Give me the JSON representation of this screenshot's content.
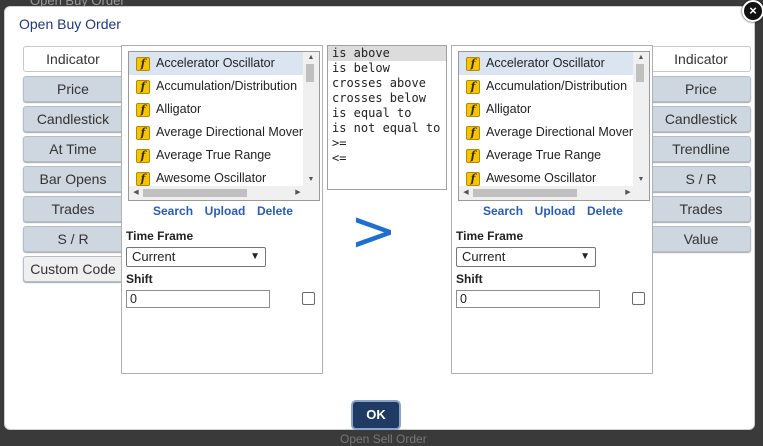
{
  "backdrop": {
    "top_text": "Open Buy Order",
    "bottom_text": "Open Sell Order"
  },
  "dialog": {
    "title": "Open Buy Order",
    "close_glyph": "×"
  },
  "left_tabs": [
    {
      "label": "Indicator",
      "active": true
    },
    {
      "label": "Price"
    },
    {
      "label": "Candlestick"
    },
    {
      "label": "At Time"
    },
    {
      "label": "Bar Opens"
    },
    {
      "label": "Trades"
    },
    {
      "label": "S / R"
    },
    {
      "label": "Custom Code"
    }
  ],
  "right_tabs": [
    {
      "label": "Indicator",
      "active": true
    },
    {
      "label": "Price"
    },
    {
      "label": "Candlestick"
    },
    {
      "label": "Trendline"
    },
    {
      "label": "S / R"
    },
    {
      "label": "Trades"
    },
    {
      "label": "Value"
    }
  ],
  "left_panel": {
    "indicators": [
      "Accelerator Oscillator",
      "Accumulation/Distribution",
      "Alligator",
      "Average Directional Moven",
      "Average True Range",
      "Awesome Oscillator"
    ],
    "selected_index": 0,
    "links": {
      "search": "Search",
      "upload": "Upload",
      "delete": "Delete"
    },
    "time_frame_label": "Time Frame",
    "time_frame_value": "Current",
    "shift_label": "Shift",
    "shift_value": "0"
  },
  "right_panel": {
    "indicators": [
      "Accelerator Oscillator",
      "Accumulation/Distribution",
      "Alligator",
      "Average Directional Moven",
      "Average True Range",
      "Awesome Oscillator"
    ],
    "selected_index": 0,
    "links": {
      "search": "Search",
      "upload": "Upload",
      "delete": "Delete"
    },
    "time_frame_label": "Time Frame",
    "time_frame_value": "Current",
    "shift_label": "Shift",
    "shift_value": "0"
  },
  "operators": {
    "items": [
      "is above",
      "is below",
      "crosses above",
      "crosses below",
      "is equal to",
      "is not equal to",
      ">=",
      "<="
    ],
    "selected_index": 0
  },
  "comparison_symbol": ">",
  "ok_label": "OK",
  "icons": {
    "function": "function-icon"
  },
  "colors": {
    "title": "#1f3a78",
    "link": "#2a5db0",
    "comparison": "#1f6fd1",
    "ok_button": "#1f3b63",
    "tab_inactive": "#ced6e0"
  }
}
